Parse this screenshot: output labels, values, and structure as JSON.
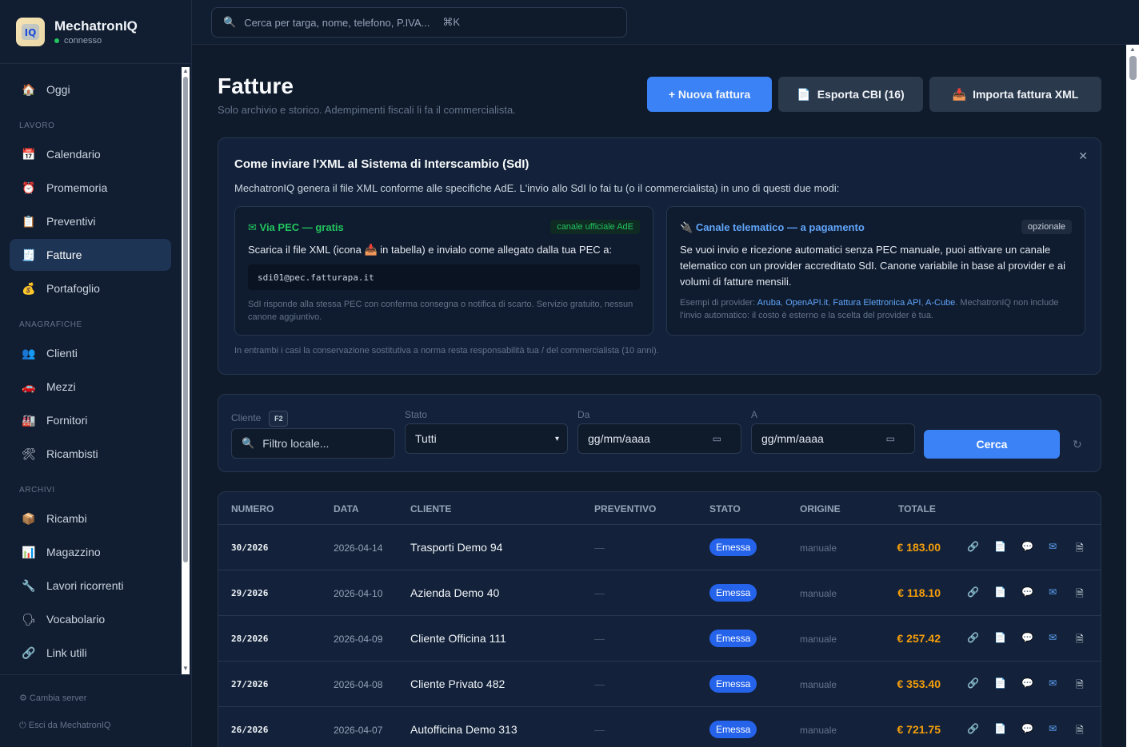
{
  "app": {
    "name": "MechatronIQ",
    "status": "connesso",
    "logo_text": "MechatronIQ"
  },
  "search": {
    "placeholder": "Cerca per targa, nome, telefono, P.IVA...",
    "shortcut": "⌘K"
  },
  "sidebar": {
    "top": [
      {
        "label": "Oggi",
        "icon": "🏠"
      }
    ],
    "sections": [
      {
        "title": "LAVORO",
        "items": [
          {
            "label": "Calendario",
            "icon": "📅"
          },
          {
            "label": "Promemoria",
            "icon": "⏰"
          },
          {
            "label": "Preventivi",
            "icon": "📋"
          },
          {
            "label": "Fatture",
            "icon": "🧾",
            "active": true
          },
          {
            "label": "Portafoglio",
            "icon": "💰"
          }
        ]
      },
      {
        "title": "ANAGRAFICHE",
        "items": [
          {
            "label": "Clienti",
            "icon": "👥"
          },
          {
            "label": "Mezzi",
            "icon": "🚗"
          },
          {
            "label": "Fornitori",
            "icon": "🏭"
          },
          {
            "label": "Ricambisti",
            "icon": "🛠"
          }
        ]
      },
      {
        "title": "ARCHIVI",
        "items": [
          {
            "label": "Ricambi",
            "icon": "📦"
          },
          {
            "label": "Magazzino",
            "icon": "📊"
          },
          {
            "label": "Lavori ricorrenti",
            "icon": "🔧"
          },
          {
            "label": "Vocabolario",
            "icon": "🗣"
          },
          {
            "label": "Link utili",
            "icon": "🔗"
          }
        ]
      }
    ],
    "footer": {
      "change_server": "⚙ Cambia server",
      "logout": "⏻ Esci da MechatronIQ"
    }
  },
  "page": {
    "title": "Fatture",
    "subtitle": "Solo archivio e storico. Adempimenti fiscali li fa il commercialista.",
    "buttons": {
      "new": "+ Nuova fattura",
      "export": "Esporta CBI (16)",
      "import": "Importa fattura XML"
    }
  },
  "info": {
    "title": "Come inviare l'XML al Sistema di Interscambio (SdI)",
    "desc": "MechatronIQ genera il file XML conforme alle specifiche AdE. L'invio allo SdI lo fai tu (o il commercialista) in uno di questi due modi:",
    "pec": {
      "title": "✉ Via PEC — gratis",
      "badge": "canale ufficiale AdE",
      "text_a": "Scarica il file XML (icona",
      "text_b": "in tabella) e invialo come allegato dalla tua PEC a:",
      "email": "sdi01@pec.fatturapa.it",
      "note": "SdI risponde alla stessa PEC con conferma consegna o notifica di scarto. Servizio gratuito, nessun canone aggiuntivo."
    },
    "telematico": {
      "title": "Canale telematico — a pagamento",
      "badge": "opzionale",
      "text": "Se vuoi invio e ricezione automatici senza PEC manuale, puoi attivare un canale telematico con un provider accreditato SdI. Canone variabile in base al provider e ai volumi di fatture mensili.",
      "note_prefix": "Esempi di provider:",
      "providers": [
        "Aruba",
        "OpenAPI.it",
        "Fattura Elettronica API",
        "A-Cube"
      ],
      "note_suffix": ". MechatronIQ non include l'invio automatico: il costo è esterno e la scelta del provider è tua."
    },
    "footer": "In entrambi i casi la conservazione sostitutiva a norma resta responsabilità tua / del commercialista (10 anni)."
  },
  "filters": {
    "cliente_label": "Cliente",
    "cliente_shortcut": "F2",
    "cliente_placeholder": "Filtro locale...",
    "stato_label": "Stato",
    "stato_value": "Tutti",
    "da_label": "Da",
    "da_placeholder": "gg/mm/aaaa",
    "a_label": "A",
    "a_placeholder": "gg/mm/aaaa",
    "search_button": "Cerca"
  },
  "table": {
    "columns": [
      "NUMERO",
      "DATA",
      "CLIENTE",
      "PREVENTIVO",
      "STATO",
      "ORIGINE",
      "TOTALE"
    ],
    "rows": [
      {
        "numero": "30/2026",
        "data": "2026-04-14",
        "cliente": "Trasporti Demo 94",
        "preventivo": "—",
        "stato": "Emessa",
        "origine": "manuale",
        "totale": "€ 183.00"
      },
      {
        "numero": "29/2026",
        "data": "2026-04-10",
        "cliente": "Azienda Demo 40",
        "preventivo": "—",
        "stato": "Emessa",
        "origine": "manuale",
        "totale": "€ 118.10"
      },
      {
        "numero": "28/2026",
        "data": "2026-04-09",
        "cliente": "Cliente Officina 111",
        "preventivo": "—",
        "stato": "Emessa",
        "origine": "manuale",
        "totale": "€ 257.42"
      },
      {
        "numero": "27/2026",
        "data": "2026-04-08",
        "cliente": "Cliente Privato 482",
        "preventivo": "—",
        "stato": "Emessa",
        "origine": "manuale",
        "totale": "€ 353.40"
      },
      {
        "numero": "26/2026",
        "data": "2026-04-07",
        "cliente": "Autofficina Demo 313",
        "preventivo": "—",
        "stato": "Emessa",
        "origine": "manuale",
        "totale": "€ 721.75"
      }
    ],
    "actions": [
      {
        "name": "link-icon",
        "glyph": "🔗"
      },
      {
        "name": "pdf-icon",
        "glyph": "📄"
      },
      {
        "name": "whatsapp-icon",
        "glyph": "💬"
      },
      {
        "name": "email-icon",
        "glyph": "✉"
      },
      {
        "name": "xml-icon",
        "glyph": "🗎"
      }
    ]
  },
  "colors": {
    "accent": "#3b82f6",
    "total": "#f59e0b",
    "pec": "#22c55e",
    "link": "#60a5fa"
  }
}
